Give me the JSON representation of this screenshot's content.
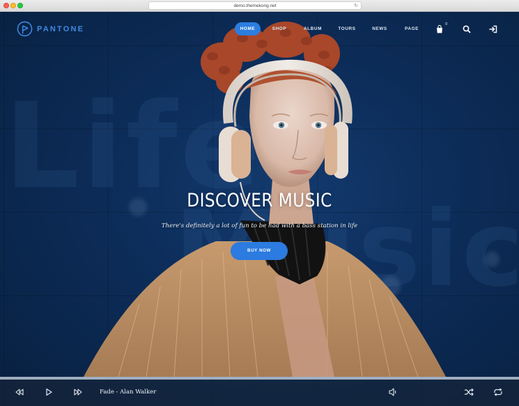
{
  "browser": {
    "url": "demo.themekong.net"
  },
  "brand": {
    "name": "PANTONE",
    "accent": "#3f8be4"
  },
  "nav": {
    "items": [
      {
        "label": "HOME",
        "active": true
      },
      {
        "label": "SHOP",
        "active": false
      },
      {
        "label": "ALBUM",
        "active": false
      },
      {
        "label": "TOURS",
        "active": false
      },
      {
        "label": "NEWS",
        "active": false
      },
      {
        "label": "PAGE",
        "active": false
      }
    ],
    "cart_count": "0",
    "icons": [
      "cart-icon",
      "search-icon",
      "login-icon"
    ]
  },
  "hero": {
    "title": "DISCOVER MUSIC",
    "subtitle": "There's definitely a lot of fun to be had with a bass station in life",
    "cta_label": "BUY NOW",
    "cta_color": "#2b7be0",
    "background_words": [
      "Life",
      "Music"
    ]
  },
  "player": {
    "track": "Fade - Alan Walker",
    "icons": [
      "previous-icon",
      "play-icon",
      "next-icon",
      "volume-icon",
      "shuffle-icon",
      "repeat-icon"
    ]
  }
}
